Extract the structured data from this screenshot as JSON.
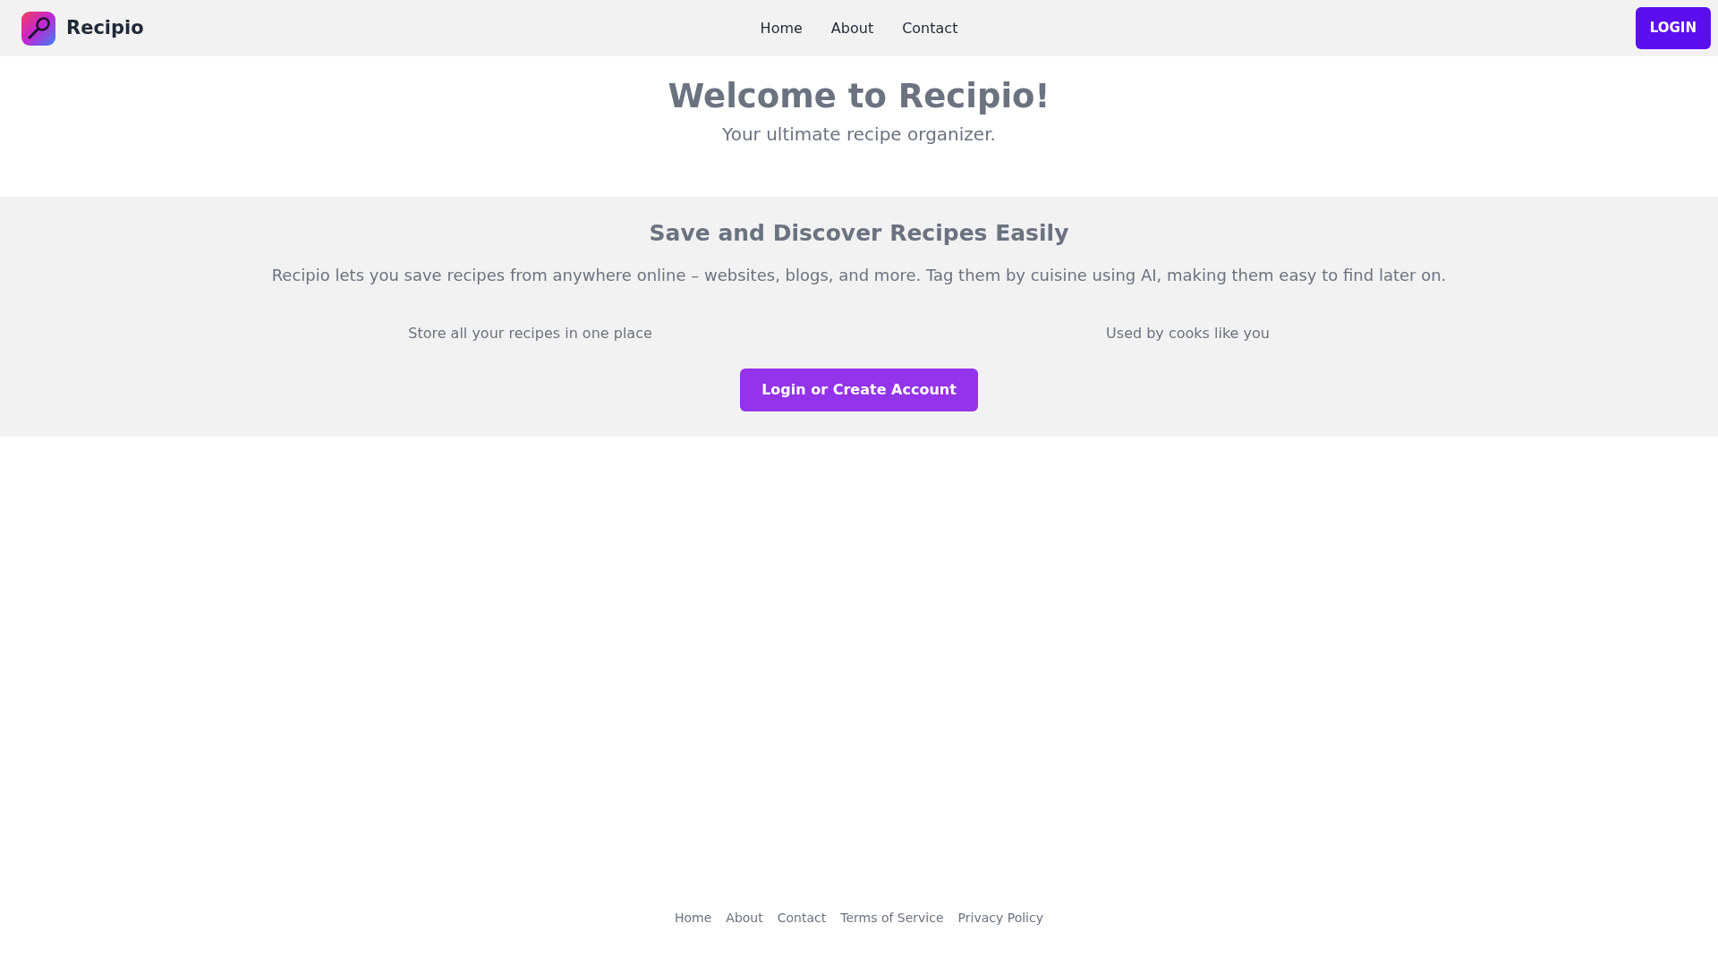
{
  "header": {
    "brand": "Recipio",
    "nav": [
      "Home",
      "About",
      "Contact"
    ],
    "login_button": "LOGIN"
  },
  "hero": {
    "title": "Welcome to Recipio!",
    "subtitle": "Your ultimate recipe organizer."
  },
  "features": {
    "title": "Save and Discover Recipes Easily",
    "description": "Recipio lets you save recipes from anywhere online – websites, blogs, and more. Tag them by cuisine using AI, making them easy to find later on.",
    "points": [
      "Store all your recipes in one place",
      "Used by cooks like you"
    ],
    "cta_button": "Login or Create Account"
  },
  "footer": {
    "links": [
      "Home",
      "About",
      "Contact",
      "Terms of Service",
      "Privacy Policy"
    ]
  }
}
